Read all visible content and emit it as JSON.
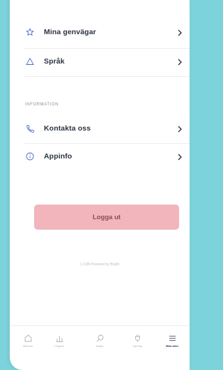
{
  "menu": {
    "shortcuts_label": "Mina genvägar",
    "language_label": "Språk"
  },
  "information": {
    "section_title": "INFORMATION",
    "contact_label": "Kontakta oss",
    "appinfo_label": "Appinfo"
  },
  "logout_label": "Logga ut",
  "version_text": "1.2.88 Powered by Bright",
  "tabs": [
    {
      "label": "Mitt hem",
      "icon": "home-icon"
    },
    {
      "label": "Prognos",
      "icon": "bar-chart-icon"
    },
    {
      "label": "Analys",
      "icon": "search-icon"
    },
    {
      "label": "Styrning",
      "icon": "plug-icon"
    },
    {
      "label": "Mina sidor",
      "icon": "menu-icon"
    }
  ],
  "colors": {
    "background": "#7dd3db",
    "accent_button": "#f1b5bb",
    "text_primary": "#2a3340"
  }
}
